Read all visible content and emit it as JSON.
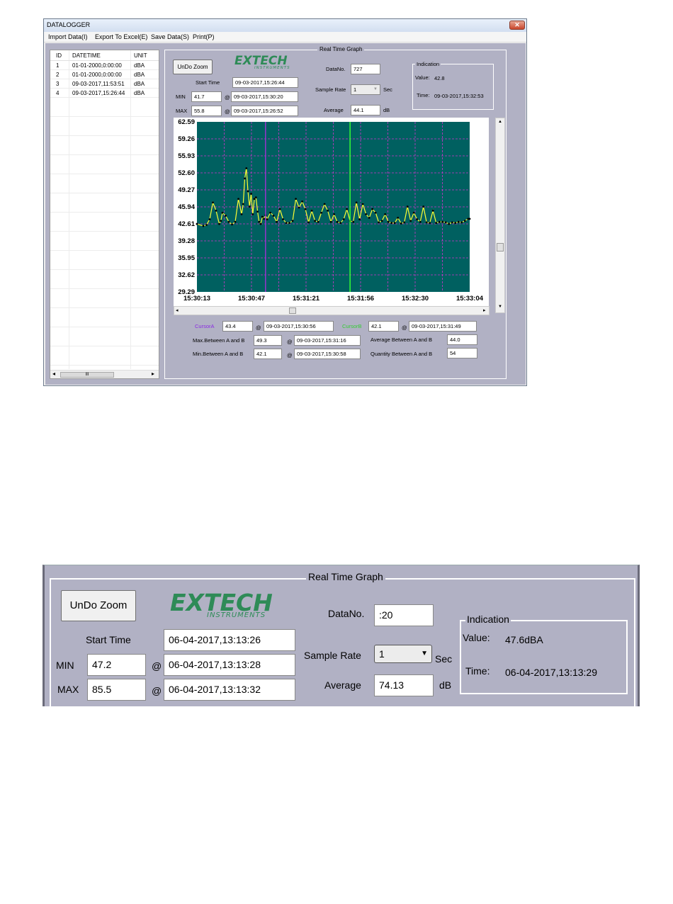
{
  "window": {
    "title": "DATALOGGER",
    "close_glyph": "✕",
    "menu": [
      "Import Data(I)",
      "Export To Excel(E)",
      "Save Data(S)",
      "Print(P)"
    ]
  },
  "data_list": {
    "columns": [
      "ID",
      "DATETIME",
      "UNIT"
    ],
    "rows": [
      [
        "1",
        "01-01-2000,0:00:00",
        "dBA"
      ],
      [
        "2",
        "01-01-2000,0:00:00",
        "dBA"
      ],
      [
        "3",
        "09-03-2017,11:53:51",
        "dBA"
      ],
      [
        "4",
        "09-03-2017,15:26:44",
        "dBA"
      ]
    ],
    "scroll_left": "◂",
    "scroll_thumb": "III",
    "scroll_right": "▸"
  },
  "graph": {
    "frame_title": "Real Time Graph",
    "undo_zoom": "UnDo Zoom",
    "logo": "EXTECH",
    "logo_sub": "INSTRUMENTS",
    "start_time_label": "Start Time",
    "start_time": "09-03-2017,15:26:44",
    "min_label": "MIN",
    "min_value": "41.7",
    "min_time": "09-03-2017,15:30:20",
    "max_label": "MAX",
    "max_value": "55.8",
    "max_time": "09-03-2017,15:26:52",
    "at": "@",
    "datano_label": "DataNo.",
    "datano": "727",
    "sample_rate_label": "Sample Rate",
    "sample_rate": "1",
    "sec": "Sec",
    "average_label": "Average",
    "average": "44.1",
    "db": "dB",
    "indication": {
      "title": "Indication",
      "value_label": "Value:",
      "value": "42.8",
      "time_label": "Time:",
      "time": "09-03-2017,15:32:53"
    },
    "cursor_a_label": "CursorA",
    "cursor_a_value": "43.4",
    "cursor_a_time": "09-03-2017,15:30:56",
    "cursor_b_label": "CursorB",
    "cursor_b_value": "42.1",
    "cursor_b_time": "09-03-2017,15:31:49",
    "max_ab_label": "Max.Between A and B",
    "max_ab_value": "49.3",
    "max_ab_time": "09-03-2017,15:31:16",
    "min_ab_label": "Min.Between A and B",
    "min_ab_value": "42.1",
    "min_ab_time": "09-03-2017,15:30:58",
    "avg_ab_label": "Average Between A and B",
    "avg_ab_value": "44.0",
    "qty_ab_label": "Quantity Between A and B",
    "qty_ab_value": "54",
    "colors": {
      "plot_bg": "#006060",
      "trace": "#ffff33",
      "dots": "#000000",
      "grid": "#cc33cc",
      "cursor_a": "#9933cc",
      "cursor_b": "#33ff33"
    }
  },
  "chart_data": {
    "type": "line",
    "title": "",
    "xlabel": "",
    "ylabel": "",
    "ylim": [
      29.29,
      62.59
    ],
    "yticks": [
      "62.59",
      "59.26",
      "55.93",
      "52.60",
      "49.27",
      "45.94",
      "42.61",
      "39.28",
      "35.95",
      "32.62",
      "29.29"
    ],
    "xticks": [
      "15:30:13",
      "15:30:47",
      "15:31:21",
      "15:31:56",
      "15:32:30",
      "15:33:04"
    ],
    "x_seconds": [
      0,
      4,
      6,
      8,
      10,
      12,
      14,
      15,
      16,
      18,
      20,
      22,
      24,
      26,
      28,
      29,
      30,
      31,
      32,
      33,
      34,
      35,
      36,
      37,
      38,
      39,
      40,
      41,
      42,
      43,
      44,
      46,
      48,
      50,
      52,
      54,
      56,
      58,
      60,
      62,
      64,
      66,
      68,
      70,
      72,
      74,
      76,
      78,
      80,
      82,
      84,
      86,
      88,
      90,
      92,
      94,
      96,
      98,
      100,
      102,
      104,
      106,
      108,
      110,
      112,
      114,
      116,
      118,
      120,
      122,
      124,
      126,
      128,
      130,
      132,
      134,
      136,
      138,
      140,
      142,
      144,
      146,
      148,
      150,
      152,
      154,
      156,
      158,
      160,
      162,
      164,
      166,
      168,
      170,
      171
    ],
    "values": [
      42.6,
      42.2,
      42.4,
      43.5,
      46.8,
      45.2,
      42.6,
      43.2,
      44.8,
      44.2,
      43.0,
      42.5,
      43.0,
      47.5,
      44.5,
      46.5,
      51.5,
      53.5,
      49.0,
      46.0,
      48.5,
      44.5,
      47.5,
      47.8,
      45.0,
      43.0,
      42.6,
      44.0,
      43.6,
      44.3,
      43.5,
      44.8,
      44.2,
      43.0,
      45.5,
      43.5,
      42.8,
      42.8,
      43.2,
      47.5,
      45.8,
      47.0,
      45.5,
      42.9,
      45.2,
      43.2,
      43.0,
      44.8,
      46.5,
      45.2,
      43.0,
      44.5,
      43.0,
      42.8,
      43.5,
      45.5,
      43.2,
      43.0,
      46.8,
      43.5,
      46.5,
      44.5,
      43.8,
      45.5,
      44.8,
      42.9,
      43.2,
      44.5,
      43.0,
      42.8,
      42.8,
      43.8,
      42.7,
      42.9,
      46.0,
      43.2,
      44.8,
      43.5,
      43.0,
      46.0,
      42.9,
      42.8,
      45.2,
      42.8,
      43.0,
      43.0,
      42.9,
      42.6,
      42.9,
      42.8,
      43.0,
      42.9,
      43.2,
      43.6,
      43.6
    ],
    "cursor_a_x": 43,
    "cursor_b_x": 96,
    "grid": true
  },
  "zoom_view": {
    "frame_title": "Real Time Graph",
    "undo_zoom": "UnDo Zoom",
    "logo": "EXTECH",
    "logo_sub": "INSTRUMENTS",
    "start_time_label": "Start Time",
    "start_time": "06-04-2017,13:13:26",
    "min_label": "MIN",
    "min_value": "47.2",
    "min_time": "06-04-2017,13:13:28",
    "max_label": "MAX",
    "max_value": "85.5",
    "max_time": "06-04-2017,13:13:32",
    "at": "@",
    "datano_label": "DataNo.",
    "datano": ":20",
    "sample_rate_label": "Sample Rate",
    "sample_rate": "1",
    "sec": "Sec",
    "average_label": "Average",
    "average": "74.13",
    "db": "dB",
    "indication_title": "Indication",
    "value_label": "Value:",
    "value": "47.6dBA",
    "time_label": "Time:",
    "time": "06-04-2017,13:13:29"
  }
}
